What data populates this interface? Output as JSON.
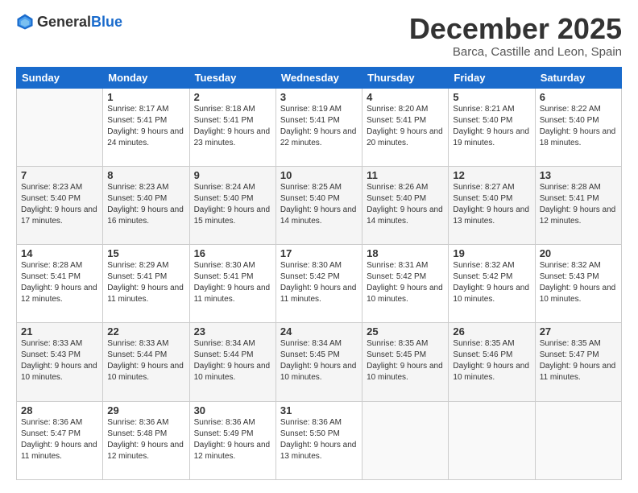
{
  "logo": {
    "general": "General",
    "blue": "Blue"
  },
  "header": {
    "month": "December 2025",
    "location": "Barca, Castille and Leon, Spain"
  },
  "weekdays": [
    "Sunday",
    "Monday",
    "Tuesday",
    "Wednesday",
    "Thursday",
    "Friday",
    "Saturday"
  ],
  "weeks": [
    [
      {
        "date": "",
        "sunrise": "",
        "sunset": "",
        "daylight": ""
      },
      {
        "date": "1",
        "sunrise": "Sunrise: 8:17 AM",
        "sunset": "Sunset: 5:41 PM",
        "daylight": "Daylight: 9 hours and 24 minutes."
      },
      {
        "date": "2",
        "sunrise": "Sunrise: 8:18 AM",
        "sunset": "Sunset: 5:41 PM",
        "daylight": "Daylight: 9 hours and 23 minutes."
      },
      {
        "date": "3",
        "sunrise": "Sunrise: 8:19 AM",
        "sunset": "Sunset: 5:41 PM",
        "daylight": "Daylight: 9 hours and 22 minutes."
      },
      {
        "date": "4",
        "sunrise": "Sunrise: 8:20 AM",
        "sunset": "Sunset: 5:41 PM",
        "daylight": "Daylight: 9 hours and 20 minutes."
      },
      {
        "date": "5",
        "sunrise": "Sunrise: 8:21 AM",
        "sunset": "Sunset: 5:40 PM",
        "daylight": "Daylight: 9 hours and 19 minutes."
      },
      {
        "date": "6",
        "sunrise": "Sunrise: 8:22 AM",
        "sunset": "Sunset: 5:40 PM",
        "daylight": "Daylight: 9 hours and 18 minutes."
      }
    ],
    [
      {
        "date": "7",
        "sunrise": "Sunrise: 8:23 AM",
        "sunset": "Sunset: 5:40 PM",
        "daylight": "Daylight: 9 hours and 17 minutes."
      },
      {
        "date": "8",
        "sunrise": "Sunrise: 8:23 AM",
        "sunset": "Sunset: 5:40 PM",
        "daylight": "Daylight: 9 hours and 16 minutes."
      },
      {
        "date": "9",
        "sunrise": "Sunrise: 8:24 AM",
        "sunset": "Sunset: 5:40 PM",
        "daylight": "Daylight: 9 hours and 15 minutes."
      },
      {
        "date": "10",
        "sunrise": "Sunrise: 8:25 AM",
        "sunset": "Sunset: 5:40 PM",
        "daylight": "Daylight: 9 hours and 14 minutes."
      },
      {
        "date": "11",
        "sunrise": "Sunrise: 8:26 AM",
        "sunset": "Sunset: 5:40 PM",
        "daylight": "Daylight: 9 hours and 14 minutes."
      },
      {
        "date": "12",
        "sunrise": "Sunrise: 8:27 AM",
        "sunset": "Sunset: 5:40 PM",
        "daylight": "Daylight: 9 hours and 13 minutes."
      },
      {
        "date": "13",
        "sunrise": "Sunrise: 8:28 AM",
        "sunset": "Sunset: 5:41 PM",
        "daylight": "Daylight: 9 hours and 12 minutes."
      }
    ],
    [
      {
        "date": "14",
        "sunrise": "Sunrise: 8:28 AM",
        "sunset": "Sunset: 5:41 PM",
        "daylight": "Daylight: 9 hours and 12 minutes."
      },
      {
        "date": "15",
        "sunrise": "Sunrise: 8:29 AM",
        "sunset": "Sunset: 5:41 PM",
        "daylight": "Daylight: 9 hours and 11 minutes."
      },
      {
        "date": "16",
        "sunrise": "Sunrise: 8:30 AM",
        "sunset": "Sunset: 5:41 PM",
        "daylight": "Daylight: 9 hours and 11 minutes."
      },
      {
        "date": "17",
        "sunrise": "Sunrise: 8:30 AM",
        "sunset": "Sunset: 5:42 PM",
        "daylight": "Daylight: 9 hours and 11 minutes."
      },
      {
        "date": "18",
        "sunrise": "Sunrise: 8:31 AM",
        "sunset": "Sunset: 5:42 PM",
        "daylight": "Daylight: 9 hours and 10 minutes."
      },
      {
        "date": "19",
        "sunrise": "Sunrise: 8:32 AM",
        "sunset": "Sunset: 5:42 PM",
        "daylight": "Daylight: 9 hours and 10 minutes."
      },
      {
        "date": "20",
        "sunrise": "Sunrise: 8:32 AM",
        "sunset": "Sunset: 5:43 PM",
        "daylight": "Daylight: 9 hours and 10 minutes."
      }
    ],
    [
      {
        "date": "21",
        "sunrise": "Sunrise: 8:33 AM",
        "sunset": "Sunset: 5:43 PM",
        "daylight": "Daylight: 9 hours and 10 minutes."
      },
      {
        "date": "22",
        "sunrise": "Sunrise: 8:33 AM",
        "sunset": "Sunset: 5:44 PM",
        "daylight": "Daylight: 9 hours and 10 minutes."
      },
      {
        "date": "23",
        "sunrise": "Sunrise: 8:34 AM",
        "sunset": "Sunset: 5:44 PM",
        "daylight": "Daylight: 9 hours and 10 minutes."
      },
      {
        "date": "24",
        "sunrise": "Sunrise: 8:34 AM",
        "sunset": "Sunset: 5:45 PM",
        "daylight": "Daylight: 9 hours and 10 minutes."
      },
      {
        "date": "25",
        "sunrise": "Sunrise: 8:35 AM",
        "sunset": "Sunset: 5:45 PM",
        "daylight": "Daylight: 9 hours and 10 minutes."
      },
      {
        "date": "26",
        "sunrise": "Sunrise: 8:35 AM",
        "sunset": "Sunset: 5:46 PM",
        "daylight": "Daylight: 9 hours and 10 minutes."
      },
      {
        "date": "27",
        "sunrise": "Sunrise: 8:35 AM",
        "sunset": "Sunset: 5:47 PM",
        "daylight": "Daylight: 9 hours and 11 minutes."
      }
    ],
    [
      {
        "date": "28",
        "sunrise": "Sunrise: 8:36 AM",
        "sunset": "Sunset: 5:47 PM",
        "daylight": "Daylight: 9 hours and 11 minutes."
      },
      {
        "date": "29",
        "sunrise": "Sunrise: 8:36 AM",
        "sunset": "Sunset: 5:48 PM",
        "daylight": "Daylight: 9 hours and 12 minutes."
      },
      {
        "date": "30",
        "sunrise": "Sunrise: 8:36 AM",
        "sunset": "Sunset: 5:49 PM",
        "daylight": "Daylight: 9 hours and 12 minutes."
      },
      {
        "date": "31",
        "sunrise": "Sunrise: 8:36 AM",
        "sunset": "Sunset: 5:50 PM",
        "daylight": "Daylight: 9 hours and 13 minutes."
      },
      {
        "date": "",
        "sunrise": "",
        "sunset": "",
        "daylight": ""
      },
      {
        "date": "",
        "sunrise": "",
        "sunset": "",
        "daylight": ""
      },
      {
        "date": "",
        "sunrise": "",
        "sunset": "",
        "daylight": ""
      }
    ]
  ]
}
